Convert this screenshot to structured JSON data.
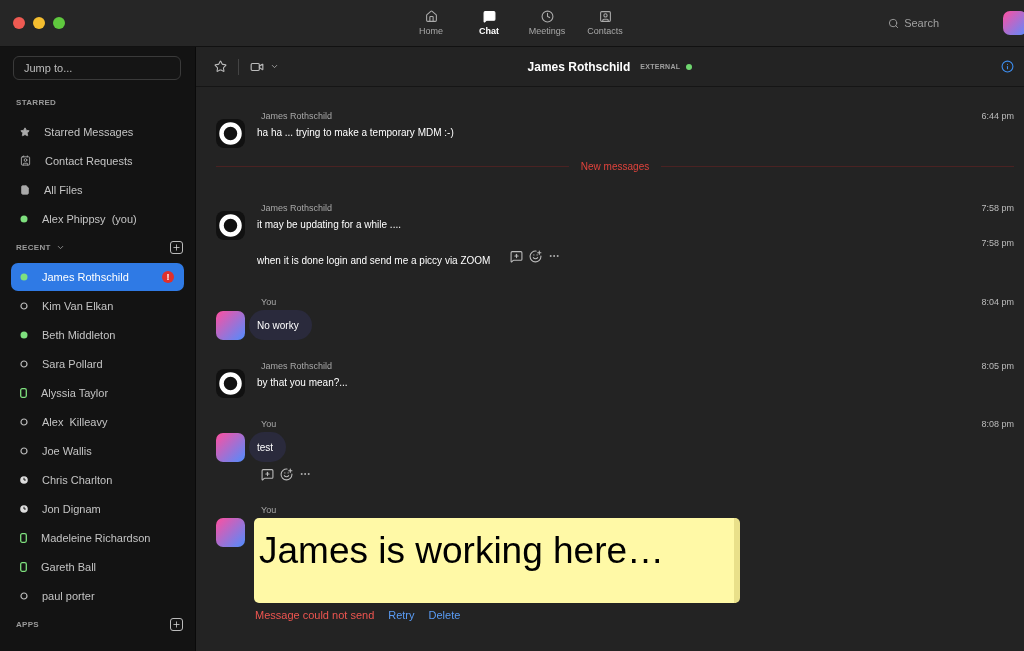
{
  "nav": {
    "tabs": [
      {
        "label": "Home",
        "kind": "home",
        "selected": false
      },
      {
        "label": "Chat",
        "kind": "chat",
        "selected": true
      },
      {
        "label": "Meetings",
        "kind": "meetings",
        "selected": false
      },
      {
        "label": "Contacts",
        "kind": "contacts",
        "selected": false
      }
    ]
  },
  "search": {
    "placeholder": "Search"
  },
  "sidebar": {
    "jump": {
      "placeholder": "Jump to..."
    },
    "sections": [
      {
        "title": "STARRED",
        "has_caret": false,
        "has_add": false,
        "items": [
          {
            "label": "Starred Messages",
            "kind": "starred",
            "selected": false
          },
          {
            "label": "Contact Requests",
            "kind": "requests",
            "selected": false
          },
          {
            "label": "All Files",
            "kind": "files",
            "selected": false
          },
          {
            "label": "Alex Phippsy  (you)",
            "kind": "online",
            "selected": false
          }
        ]
      },
      {
        "title": "RECENT",
        "has_caret": true,
        "has_add": true,
        "items": [
          {
            "label": "James Rothschild",
            "kind": "online",
            "selected": true,
            "badge": "!"
          },
          {
            "label": "Kim Van Elkan",
            "kind": "offline",
            "selected": false
          },
          {
            "label": "Beth Middleton",
            "kind": "online",
            "selected": false
          },
          {
            "label": "Sara Pollard",
            "kind": "offline",
            "selected": false
          },
          {
            "label": "Alyssia Taylor",
            "kind": "mobile",
            "selected": false
          },
          {
            "label": "Alex  Killeavy",
            "kind": "offline",
            "selected": false
          },
          {
            "label": "Joe Wallis",
            "kind": "offline",
            "selected": false
          },
          {
            "label": "Chris Charlton",
            "kind": "away",
            "selected": false
          },
          {
            "label": "Jon Dignam",
            "kind": "away",
            "selected": false
          },
          {
            "label": "Madeleine Richardson",
            "kind": "mobile",
            "selected": false
          },
          {
            "label": "Gareth Ball",
            "kind": "mobile",
            "selected": false
          },
          {
            "label": "paul porter",
            "kind": "offline",
            "selected": false
          }
        ]
      },
      {
        "title": "APPS",
        "has_caret": false,
        "has_add": true
      }
    ]
  },
  "chat_header": {
    "title": "James Rothschild",
    "tag": "EXTERNAL",
    "online": true
  },
  "messages": [
    {
      "kind": "incoming",
      "sender": "James Rothschild",
      "time": "6:44 pm",
      "lines": [
        {
          "text": "ha ha ... trying to make a temporary MDM :-)",
          "bubble": false,
          "actions": false
        }
      ]
    },
    {
      "kind": "divider",
      "text": "New messages"
    },
    {
      "kind": "incoming",
      "sender": "James Rothschild",
      "time": "7:58 pm",
      "lines": [
        {
          "text": "it may be updating for a while ....",
          "bubble": false,
          "actions": false
        },
        {
          "text": "when it is done login and send me a piccy via ZOOM",
          "time": "7:58 pm",
          "bubble": false,
          "actions": true
        }
      ]
    },
    {
      "kind": "outgoing",
      "sender": "You",
      "time": "8:04 pm",
      "lines": [
        {
          "text": "No worky",
          "bubble": true,
          "actions": false
        }
      ]
    },
    {
      "kind": "incoming",
      "sender": "James Rothschild",
      "time": "8:05 pm",
      "lines": [
        {
          "text": "by that you mean?...",
          "bubble": false,
          "actions": false
        }
      ]
    },
    {
      "kind": "outgoing",
      "sender": "You",
      "time": "8:08 pm",
      "lines": [
        {
          "text": "test",
          "bubble": true,
          "actions": true
        }
      ]
    },
    {
      "kind": "failed",
      "sender": "You",
      "note": "James is working here…",
      "error": "Message could not send",
      "retry": "Retry",
      "delete": "Delete"
    }
  ]
}
